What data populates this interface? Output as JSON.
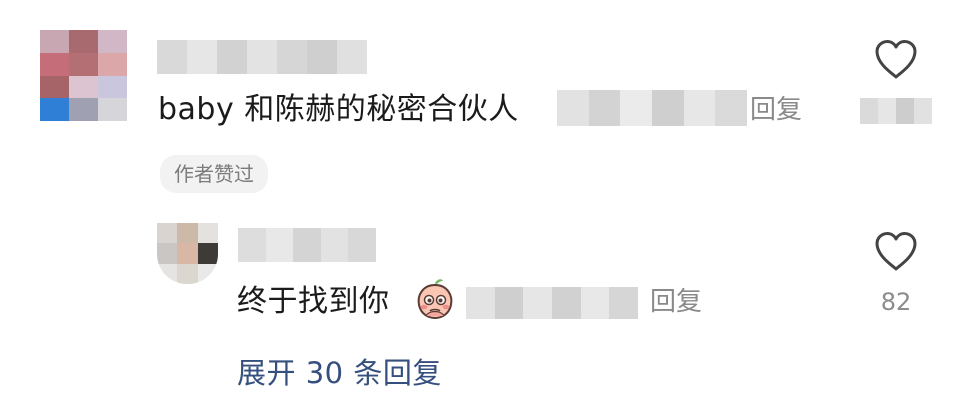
{
  "comment": {
    "text": "baby 和陈赫的秘密合伙人",
    "reply_label": "回复",
    "author_badge": "作者赞过",
    "like_icon": "heart-outline-icon"
  },
  "reply": {
    "text": "终于找到你",
    "emoji": "peach-shy-face-emoji",
    "reply_label": "回复",
    "like_icon": "heart-outline-icon",
    "like_count": "82"
  },
  "expand": {
    "label": "展开 30 条回复"
  },
  "colors": {
    "text": "#1b1b1b",
    "muted": "#8a8a8a",
    "link": "#35507e",
    "badge_bg": "#f2f2f2"
  }
}
